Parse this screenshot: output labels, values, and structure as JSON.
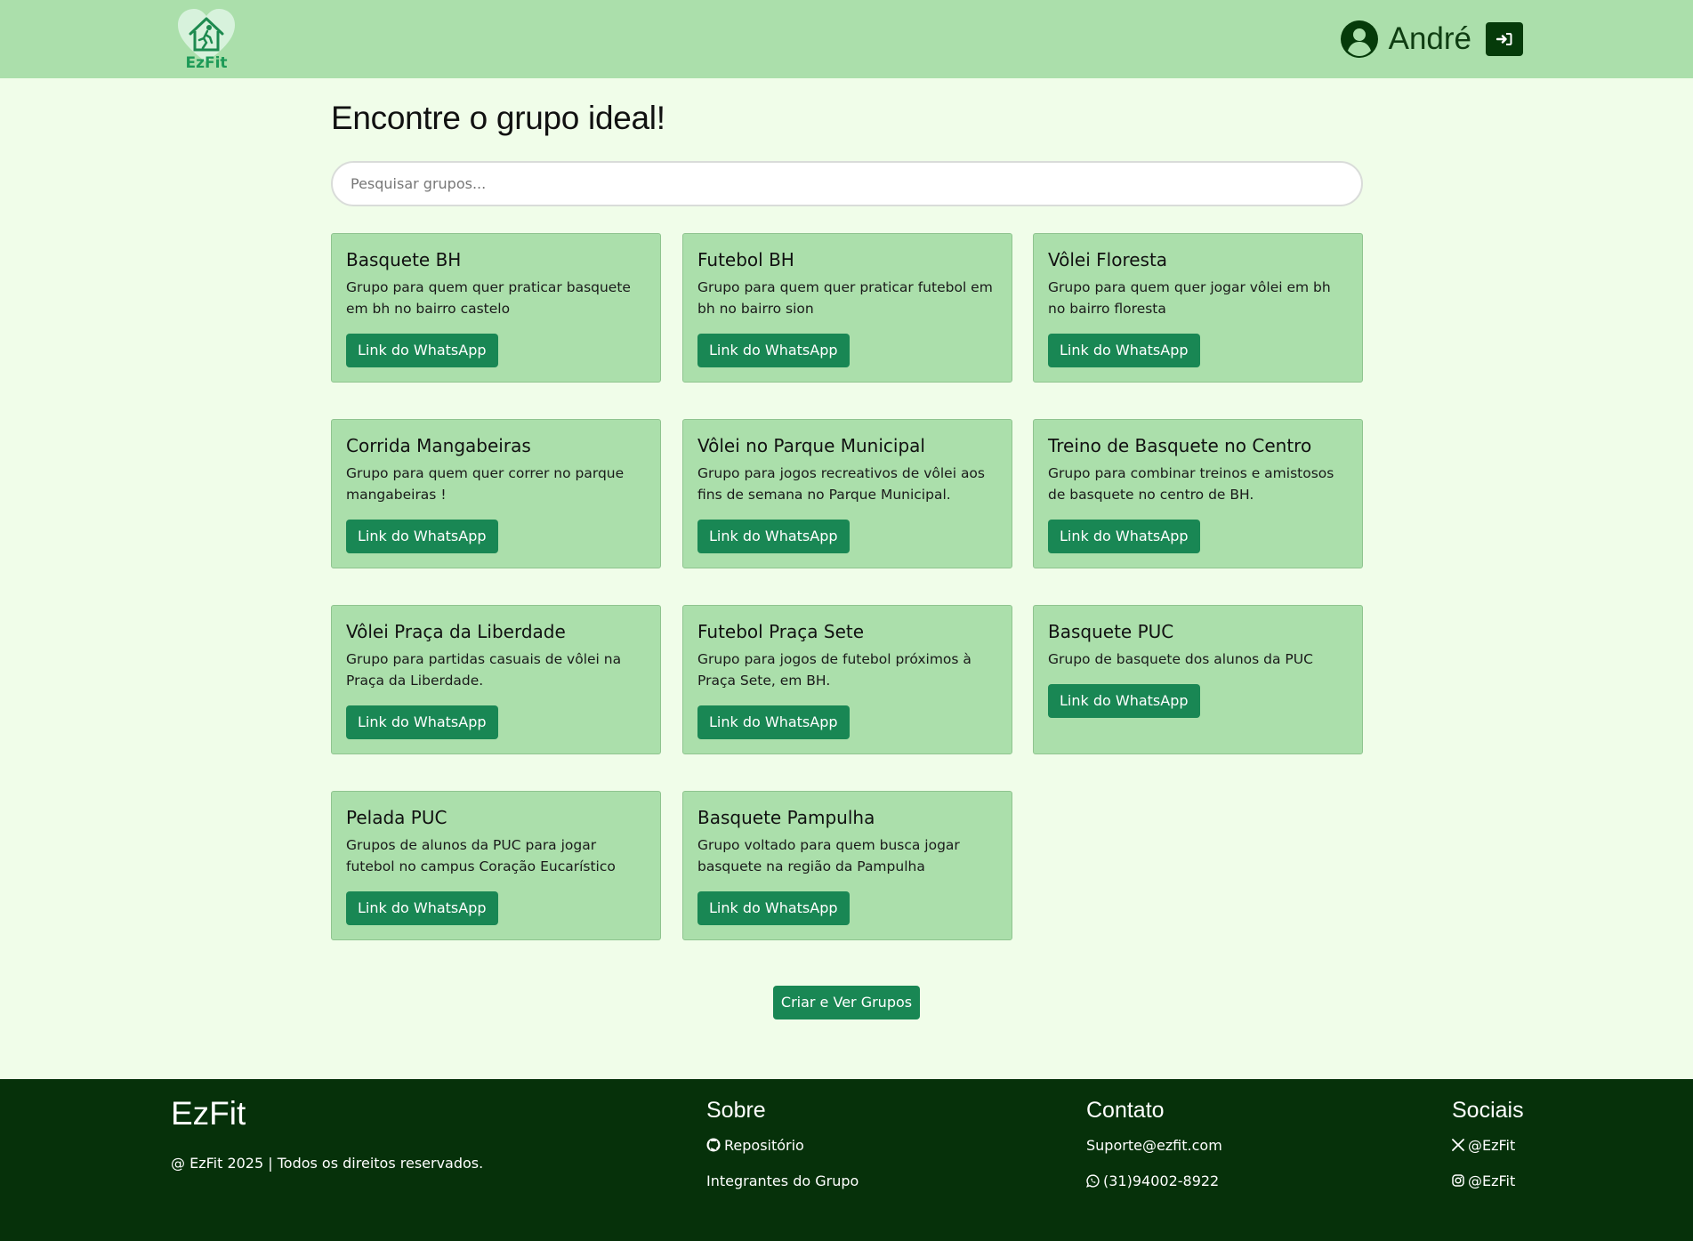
{
  "header": {
    "logo_text": "EzFit",
    "user_name": "André",
    "user_icon": "user-circle-icon",
    "logout_icon": "sign-in-icon"
  },
  "main": {
    "title": "Encontre o grupo ideal!",
    "search_placeholder": "Pesquisar grupos...",
    "groups": [
      {
        "title": "Basquete BH",
        "description": "Grupo para quem quer praticar basquete em bh no bairro castelo",
        "button": "Link do WhatsApp"
      },
      {
        "title": "Futebol BH",
        "description": "Grupo para quem quer praticar futebol em bh no bairro sion",
        "button": "Link do WhatsApp"
      },
      {
        "title": "Vôlei Floresta",
        "description": "Grupo para quem quer jogar vôlei em bh no bairro floresta",
        "button": "Link do WhatsApp"
      },
      {
        "title": "Corrida Mangabeiras",
        "description": "Grupo para quem quer correr no parque mangabeiras !",
        "button": "Link do WhatsApp"
      },
      {
        "title": "Vôlei no Parque Municipal",
        "description": "Grupo para jogos recreativos de vôlei aos fins de semana no Parque Municipal.",
        "button": "Link do WhatsApp"
      },
      {
        "title": "Treino de Basquete no Centro",
        "description": "Grupo para combinar treinos e amistosos de basquete no centro de BH.",
        "button": "Link do WhatsApp"
      },
      {
        "title": "Vôlei Praça da Liberdade",
        "description": "Grupo para partidas casuais de vôlei na Praça da Liberdade.",
        "button": "Link do WhatsApp"
      },
      {
        "title": "Futebol Praça Sete",
        "description": "Grupo para jogos de futebol próximos à Praça Sete, em BH.",
        "button": "Link do WhatsApp"
      },
      {
        "title": "Basquete PUC",
        "description": "Grupo de basquete dos alunos da PUC",
        "button": "Link do WhatsApp"
      },
      {
        "title": "Pelada PUC",
        "description": "Grupos de alunos da PUC para jogar futebol no campus Coração Eucarístico",
        "button": "Link do WhatsApp"
      },
      {
        "title": "Basquete Pampulha",
        "description": "Grupo voltado para quem busca jogar basquete na região da Pampulha",
        "button": "Link do WhatsApp"
      }
    ],
    "create_button": "Criar e Ver Grupos"
  },
  "footer": {
    "brand": "EzFit",
    "copyright": "@ EzFit 2025 | Todos os direitos reservados.",
    "sobre": {
      "title": "Sobre",
      "repo": "Repositório",
      "members": "Integrantes do Grupo"
    },
    "contato": {
      "title": "Contato",
      "email": "Suporte@ezfit.com",
      "phone": "(31)94002-8922"
    },
    "sociais": {
      "title": "Sociais",
      "x": "@EzFit",
      "instagram": "@EzFit"
    }
  },
  "colors": {
    "header_bg": "#abdfab",
    "page_bg": "#f0fde9",
    "card_bg": "#abdfab",
    "button": "#198754",
    "footer_bg": "#06310a"
  }
}
